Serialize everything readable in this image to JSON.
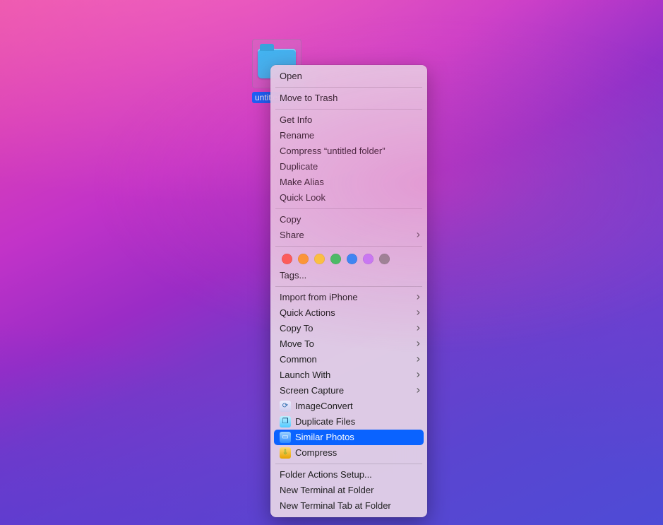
{
  "desktop": {
    "folder_label": "untitled folder"
  },
  "menu": {
    "open": "Open",
    "move_to_trash": "Move to Trash",
    "get_info": "Get Info",
    "rename": "Rename",
    "compress_named": "Compress “untitled folder”",
    "duplicate": "Duplicate",
    "make_alias": "Make Alias",
    "quick_look": "Quick Look",
    "copy": "Copy",
    "share": "Share",
    "tags_label": "Tags...",
    "import_iphone": "Import from iPhone",
    "quick_actions": "Quick Actions",
    "copy_to": "Copy To",
    "move_to": "Move To",
    "common": "Common",
    "launch_with": "Launch With",
    "screen_capture": "Screen Capture",
    "image_convert": "ImageConvert",
    "duplicate_files": "Duplicate Files",
    "similar_photos": "Similar Photos",
    "compress_app": "Compress",
    "folder_actions": "Folder Actions Setup...",
    "new_term_at": "New Terminal at Folder",
    "new_term_tab": "New Terminal Tab at Folder"
  },
  "tag_colors": [
    "red",
    "orange",
    "yellow",
    "green",
    "blue",
    "purple",
    "gray"
  ]
}
